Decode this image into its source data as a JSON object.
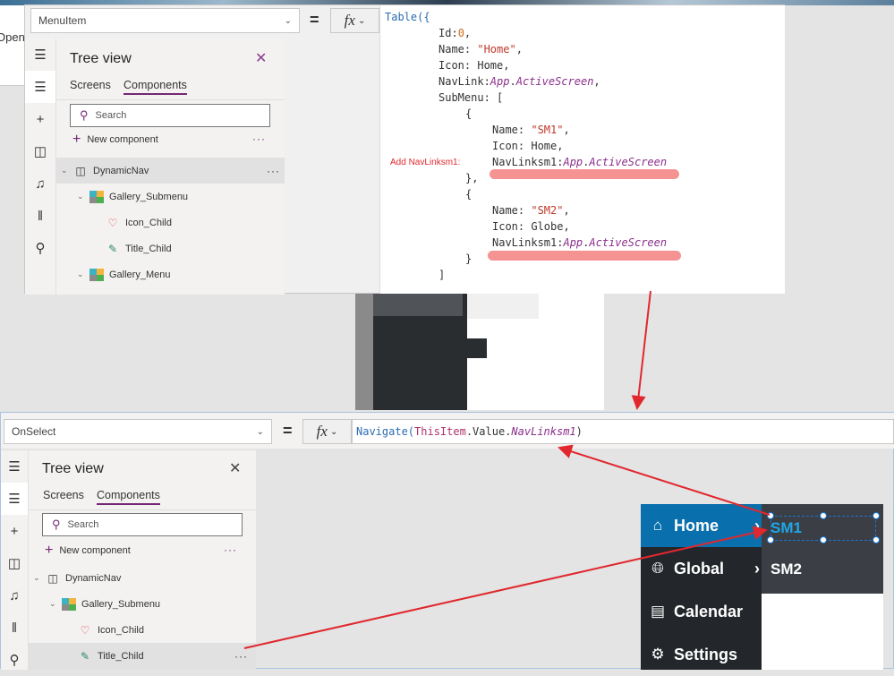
{
  "background_app": {
    "open_label": "Open"
  },
  "top_panel": {
    "property_dropdown": "MenuItem",
    "equals": "=",
    "fx": "fx",
    "tree": {
      "title": "Tree view",
      "tabs": [
        "Screens",
        "Components"
      ],
      "active_tab": "Components",
      "search_placeholder": "Search",
      "new_component": "New component",
      "nodes": [
        {
          "label": "DynamicNav",
          "level": 0
        },
        {
          "label": "Gallery_Submenu",
          "level": 1
        },
        {
          "label": "Icon_Child",
          "level": 2
        },
        {
          "label": "Title_Child",
          "level": 2
        },
        {
          "label": "Gallery_Menu",
          "level": 1
        }
      ]
    },
    "code_lines": {
      "l1": "Table({",
      "l2a": "Id:",
      "l2b": "0",
      "l2c": ",",
      "l3a": "Name: ",
      "l3b": "\"Home\"",
      "l3c": ",",
      "l4": "Icon: Home,",
      "l5a": "NavLink:",
      "l5b": "App",
      "l5c": ".",
      "l5d": "ActiveScreen",
      "l5e": ",",
      "l6": "SubMenu: [",
      "l7": "{",
      "l8a": "Name: ",
      "l8b": "\"SM1\"",
      "l8c": ",",
      "l9": "Icon: Home,",
      "l10a": "NavLinksm1:",
      "l10b": "App",
      "l10c": ".",
      "l10d": "ActiveScreen",
      "l11": "},",
      "l12": "{",
      "l13a": "Name: ",
      "l13b": "\"SM2\"",
      "l13c": ",",
      "l14": "Icon: Globe,",
      "l15a": "NavLinksm1:",
      "l15b": "App",
      "l15c": ".",
      "l15d": "ActiveScreen",
      "l16": "}",
      "l17": "]"
    },
    "annotation": "Add NavLinksm1:"
  },
  "bottom_panel": {
    "property_dropdown": "OnSelect",
    "equals": "=",
    "fx": "fx",
    "formula": {
      "a": "Navigate(",
      "b": "ThisItem",
      "c": ".Value.",
      "d": "NavLinksm1",
      "e": ")"
    },
    "tree": {
      "title": "Tree view",
      "tabs": [
        "Screens",
        "Components"
      ],
      "active_tab": "Components",
      "search_placeholder": "Search",
      "new_component": "New component",
      "nodes": [
        {
          "label": "DynamicNav",
          "level": 0
        },
        {
          "label": "Gallery_Submenu",
          "level": 1
        },
        {
          "label": "Icon_Child",
          "level": 2
        },
        {
          "label": "Title_Child",
          "level": 2,
          "selected": true
        }
      ]
    },
    "nav_menu": [
      {
        "label": "Home",
        "icon": "home-icon",
        "has_submenu": true,
        "active": true
      },
      {
        "label": "Global",
        "icon": "globe-icon",
        "has_submenu": true
      },
      {
        "label": "Calendar",
        "icon": "calendar-icon"
      },
      {
        "label": "Settings",
        "icon": "gear-icon"
      }
    ],
    "submenu": [
      {
        "label": "SM1",
        "selected": true
      },
      {
        "label": "SM2"
      }
    ]
  },
  "colors": {
    "accent": "#742774",
    "nav_active": "#0a6fad",
    "nav_bg": "#23272b",
    "submenu_bg": "#3b3f45",
    "annotation": "#e0282e"
  }
}
